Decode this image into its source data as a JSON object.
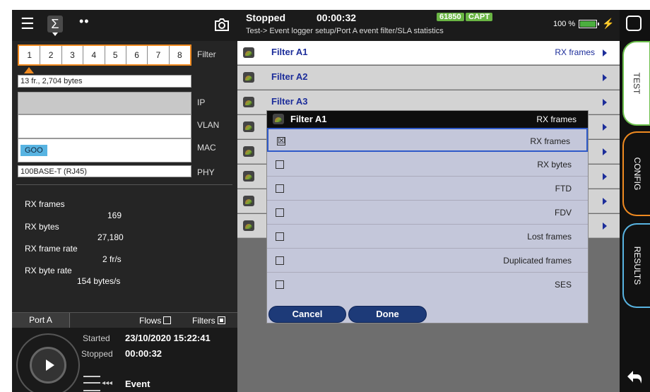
{
  "topbar": {
    "menu_icon": "hamburger-icon",
    "sigma_icon": "sigma-icon",
    "dots_icon": "more-icon",
    "camera_icon": "camera-icon",
    "sigma_glyph": "Σ",
    "dots_glyph": "••"
  },
  "filter_panel": {
    "tabs": [
      "1",
      "2",
      "3",
      "4",
      "5",
      "6",
      "7",
      "8"
    ],
    "filter_label": "Filter",
    "frames_summary": "13 fr., 2,704 bytes",
    "ip_label": "IP",
    "vlan_label": "VLAN",
    "mac_label": "MAC",
    "mac_tag": "GOO",
    "phy_value": "100BASE-T (RJ45)",
    "phy_label": "PHY"
  },
  "stats": {
    "rx_frames_label": "RX frames",
    "rx_frames_value": "169",
    "rx_bytes_label": "RX bytes",
    "rx_bytes_value": "27,180",
    "rx_frame_rate_label": "RX frame rate",
    "rx_frame_rate_value": "2 fr/s",
    "rx_byte_rate_label": "RX byte rate",
    "rx_byte_rate_value": "154 bytes/s"
  },
  "port_bar": {
    "port_tab": "Port A",
    "flows_label": "Flows",
    "filters_label": "Filters"
  },
  "runner": {
    "started_label": "Started",
    "started_value": "23/10/2020 15:22:41",
    "stopped_label": "Stopped",
    "stopped_value": "00:00:32",
    "event_arrows": "◂◂◂",
    "event_label": "Event"
  },
  "header": {
    "status": "Stopped",
    "timer": "00:00:32",
    "badge_num": "61850",
    "badge_capt": "CAPT",
    "breadcrumb": "Test-> Event logger setup/Port A event filter/SLA statistics",
    "battery_pct": "100 %",
    "bolt": "⚡",
    "status_color": "#6ab544"
  },
  "filters": [
    {
      "name": "Filter A1",
      "value": "RX frames"
    },
    {
      "name": "Filter A2",
      "value": ""
    },
    {
      "name": "Filter A3",
      "value": ""
    },
    {
      "name": "",
      "value": ""
    },
    {
      "name": "",
      "value": ""
    },
    {
      "name": "",
      "value": ""
    },
    {
      "name": "",
      "value": ""
    },
    {
      "name": "",
      "value": ""
    }
  ],
  "dialog": {
    "title": "Filter A1",
    "current": "RX frames",
    "options": [
      {
        "label": "RX frames",
        "checked": true
      },
      {
        "label": "RX bytes",
        "checked": false
      },
      {
        "label": "FTD",
        "checked": false
      },
      {
        "label": "FDV",
        "checked": false
      },
      {
        "label": "Lost frames",
        "checked": false
      },
      {
        "label": "Duplicated frames",
        "checked": false
      },
      {
        "label": "SES",
        "checked": false
      }
    ],
    "cancel_label": "Cancel",
    "done_label": "Done",
    "checked_glyph": "☒"
  },
  "rail": {
    "test_label": "TEST",
    "config_label": "CONFIG",
    "results_label": "RESULTS",
    "back_icon": "back-arrow-icon"
  }
}
